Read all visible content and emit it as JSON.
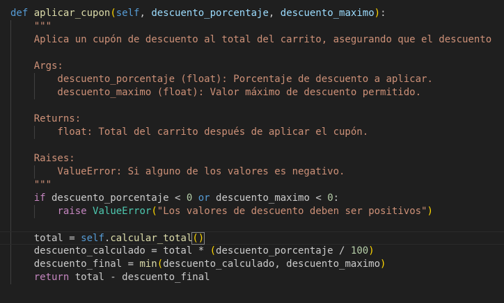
{
  "editor": {
    "language": "python",
    "lines": [
      [
        [
          "kw-def",
          "def"
        ],
        [
          "plain",
          " "
        ],
        [
          "fn",
          "aplicar_cupon"
        ],
        [
          "br1",
          "("
        ],
        [
          "self",
          "self"
        ],
        [
          "plain",
          ", "
        ],
        [
          "param",
          "descuento_porcentaje"
        ],
        [
          "plain",
          ", "
        ],
        [
          "param",
          "descuento_maximo"
        ],
        [
          "br1",
          ")"
        ],
        [
          "plain",
          ":"
        ]
      ],
      [
        [
          "str",
          "    \"\"\""
        ]
      ],
      [
        [
          "str",
          "    Aplica un cupón de descuento al total del carrito, asegurando que el descuento"
        ]
      ],
      [
        [
          "plain",
          ""
        ]
      ],
      [
        [
          "str",
          "    Args:"
        ]
      ],
      [
        [
          "str",
          "        descuento_porcentaje (float): Porcentaje de descuento a aplicar."
        ]
      ],
      [
        [
          "str",
          "        descuento_maximo (float): Valor máximo de descuento permitido."
        ]
      ],
      [
        [
          "plain",
          ""
        ]
      ],
      [
        [
          "str",
          "    Returns:"
        ]
      ],
      [
        [
          "str",
          "        float: Total del carrito después de aplicar el cupón."
        ]
      ],
      [
        [
          "plain",
          ""
        ]
      ],
      [
        [
          "str",
          "    Raises:"
        ]
      ],
      [
        [
          "str",
          "        ValueError: Si alguno de los valores es negativo."
        ]
      ],
      [
        [
          "str",
          "    \"\"\""
        ]
      ],
      [
        [
          "plain",
          "    "
        ],
        [
          "ctrl",
          "if"
        ],
        [
          "plain",
          " descuento_porcentaje < "
        ],
        [
          "num",
          "0"
        ],
        [
          "plain",
          " "
        ],
        [
          "kw-def",
          "or"
        ],
        [
          "plain",
          " descuento_maximo < "
        ],
        [
          "num",
          "0"
        ],
        [
          "plain",
          ":"
        ]
      ],
      [
        [
          "plain",
          "        "
        ],
        [
          "ctrl",
          "raise"
        ],
        [
          "plain",
          " "
        ],
        [
          "cls",
          "ValueError"
        ],
        [
          "br1",
          "("
        ],
        [
          "str",
          "\"Los valores de descuento deben ser positivos\""
        ],
        [
          "br1",
          ")"
        ]
      ],
      [
        [
          "plain",
          ""
        ]
      ],
      [
        [
          "plain",
          "    total = "
        ],
        [
          "self",
          "self"
        ],
        [
          "plain",
          "."
        ],
        [
          "fn",
          "calcular_total"
        ],
        [
          "br1",
          "()"
        ]
      ],
      [
        [
          "plain",
          "    descuento_calculado = total * "
        ],
        [
          "br1",
          "("
        ],
        [
          "plain",
          "descuento_porcentaje / "
        ],
        [
          "num",
          "100"
        ],
        [
          "br1",
          ")"
        ]
      ],
      [
        [
          "plain",
          "    descuento_final = "
        ],
        [
          "fn",
          "min"
        ],
        [
          "br1",
          "("
        ],
        [
          "plain",
          "descuento_calculado, descuento_maximo"
        ],
        [
          "br1",
          ")"
        ]
      ],
      [
        [
          "plain",
          "    "
        ],
        [
          "ctrl",
          "return"
        ],
        [
          "plain",
          " total - descuento_final"
        ]
      ]
    ],
    "current_line_index": 17
  }
}
